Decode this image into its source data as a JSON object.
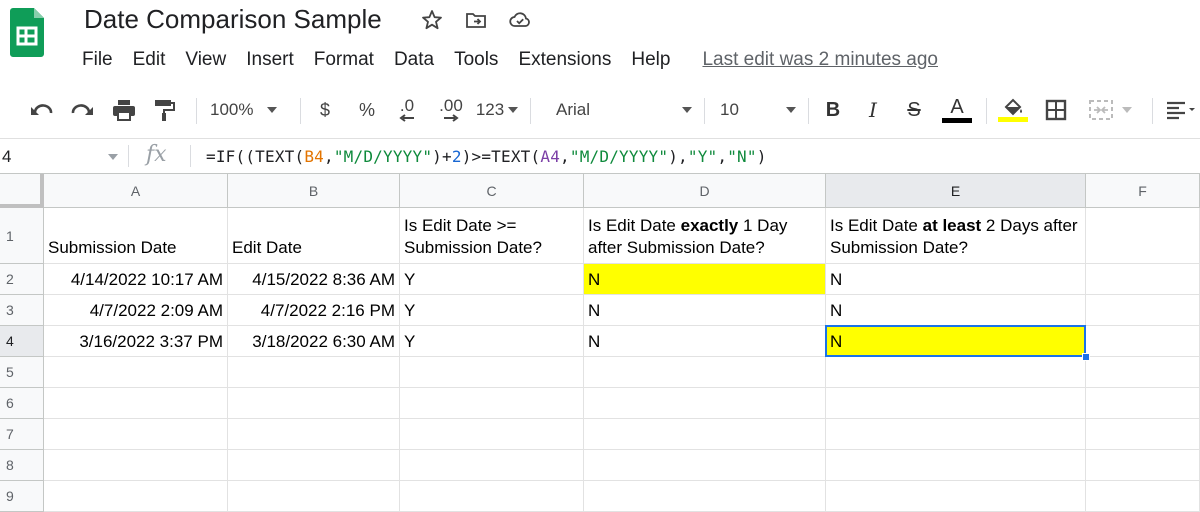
{
  "doc": {
    "title": "Date Comparison Sample",
    "last_edit": "Last edit was 2 minutes ago"
  },
  "menu": [
    "File",
    "Edit",
    "View",
    "Insert",
    "Format",
    "Data",
    "Tools",
    "Extensions",
    "Help"
  ],
  "toolbar": {
    "zoom": "100%",
    "currency": "$",
    "percent": "%",
    "decimal_decrease": ".0",
    "decimal_increase": ".00",
    "more_formats": "123",
    "font": "Arial",
    "font_size": "10",
    "bold": "B",
    "italic": "I",
    "strikethrough": "S",
    "text_color": "A",
    "text_color_swatch": "#000000",
    "fill_color_swatch": "#ffff00",
    "icons": [
      "undo-icon",
      "redo-icon",
      "print-icon",
      "paint-format-icon",
      "fill-color-icon",
      "borders-icon",
      "merge-cells-icon",
      "align-icon"
    ]
  },
  "formula_bar": {
    "name_box": "4",
    "fx": "fx",
    "formula_parts": [
      {
        "t": "=IF((TEXT(",
        "c": ""
      },
      {
        "t": "B4",
        "c": "f-b4"
      },
      {
        "t": ",",
        "c": ""
      },
      {
        "t": "\"M/D/YYYY\"",
        "c": "f-str"
      },
      {
        "t": ")+",
        "c": ""
      },
      {
        "t": "2",
        "c": "f-num"
      },
      {
        "t": ")>=TEXT(",
        "c": ""
      },
      {
        "t": "A4",
        "c": "f-a4"
      },
      {
        "t": ",",
        "c": ""
      },
      {
        "t": "\"M/D/YYYY\"",
        "c": "f-str"
      },
      {
        "t": "),",
        "c": ""
      },
      {
        "t": "\"Y\"",
        "c": "f-str"
      },
      {
        "t": ",",
        "c": ""
      },
      {
        "t": "\"N\"",
        "c": "f-str"
      },
      {
        "t": ")",
        "c": ""
      }
    ]
  },
  "grid": {
    "columns": [
      "A",
      "B",
      "C",
      "D",
      "E",
      "F"
    ],
    "active_column": "E",
    "active_row": "4",
    "row_numbers": [
      "1",
      "2",
      "3",
      "4",
      "5",
      "6",
      "7",
      "8",
      "9"
    ],
    "header_row": {
      "A": "Submission Date",
      "B": "Edit Date",
      "C": "Is Edit Date >= Submission Date?",
      "D_parts": [
        {
          "t": "Is Edit Date ",
          "b": false
        },
        {
          "t": "exactly",
          "b": true
        },
        {
          "t": " 1 Day after Submission Date?",
          "b": false
        }
      ],
      "E_parts": [
        {
          "t": "Is Edit Date ",
          "b": false
        },
        {
          "t": "at least",
          "b": true
        },
        {
          "t": " 2 Days after Submission Date?",
          "b": false
        }
      ]
    },
    "rows": [
      {
        "A": "4/14/2022 10:17 AM",
        "B": "4/15/2022 8:36 AM",
        "C": "Y",
        "D": "N",
        "E": "N",
        "D_fill": "#ffff00",
        "E_fill": ""
      },
      {
        "A": "4/7/2022 2:09 AM",
        "B": "4/7/2022 2:16 PM",
        "C": "Y",
        "D": "N",
        "E": "N",
        "D_fill": "",
        "E_fill": ""
      },
      {
        "A": "3/16/2022 3:37 PM",
        "B": "3/18/2022 6:30 AM",
        "C": "Y",
        "D": "N",
        "E": "N",
        "D_fill": "",
        "E_fill": "#ffff00"
      }
    ]
  }
}
